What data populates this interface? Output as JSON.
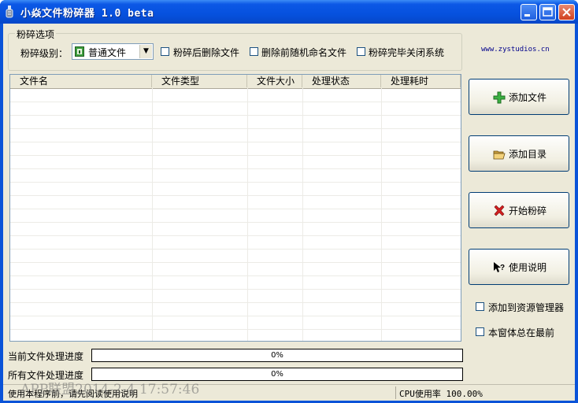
{
  "window": {
    "title": "小焱文件粉碎器 1.0 beta"
  },
  "options": {
    "group_title": "粉碎选项",
    "level_label": "粉碎级别：",
    "level_value": "普通文件",
    "delete_after_label": "粉碎后删除文件",
    "random_rename_label": "删除前随机命名文件",
    "shutdown_label": "粉碎完毕关闭系统"
  },
  "website": "www.zystudios.cn",
  "table": {
    "columns": [
      "文件名",
      "文件类型",
      "文件大小",
      "处理状态",
      "处理耗时"
    ],
    "rows": []
  },
  "actions": {
    "add_file": "添加文件",
    "add_dir": "添加目录",
    "start": "开始粉碎",
    "help": "使用说明"
  },
  "settings": {
    "add_to_explorer": "添加到资源管理器",
    "always_on_top": "本窗体总在最前"
  },
  "progress": {
    "current_label": "当前文件处理进度",
    "current_value": 0,
    "current_text": "0%",
    "all_label": "所有文件处理进度",
    "all_value": 0,
    "all_text": "0%"
  },
  "status": {
    "hint": "使用本程序前，请先阅读使用说明",
    "cpu": "CPU使用率 100.00%"
  },
  "watermark": "APP联盟2014-2-4 17:57:46"
}
